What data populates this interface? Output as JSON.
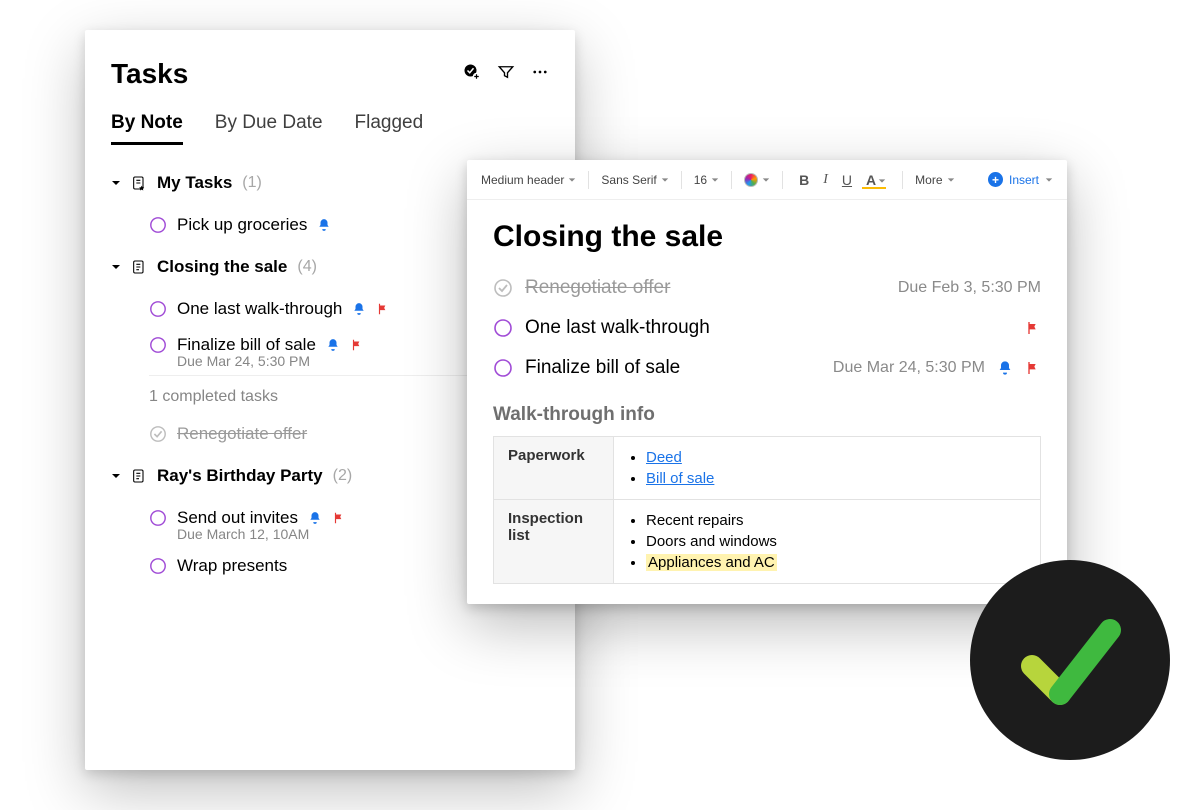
{
  "tasks_panel": {
    "title": "Tasks",
    "tabs": [
      "By Note",
      "By Due Date",
      "Flagged"
    ],
    "groups": [
      {
        "name": "My Tasks",
        "count": "(1)",
        "tasks": [
          {
            "title": "Pick up groceries",
            "subtitle": ""
          }
        ]
      },
      {
        "name": "Closing the sale",
        "count": "(4)",
        "tasks": [
          {
            "title": "One last walk-through",
            "subtitle": ""
          },
          {
            "title": "Finalize bill of sale",
            "subtitle": "Due Mar 24, 5:30 PM"
          }
        ],
        "completed_label": "1 completed tasks",
        "completed": [
          {
            "title": "Renegotiate offer"
          }
        ]
      },
      {
        "name": "Ray's Birthday Party",
        "count": "(2)",
        "tasks": [
          {
            "title": "Send out invites",
            "subtitle": "Due March 12, 10AM"
          },
          {
            "title": "Wrap presents",
            "subtitle": ""
          }
        ]
      }
    ]
  },
  "toolbar": {
    "style": "Medium header",
    "font": "Sans Serif",
    "size": "16",
    "more": "More",
    "insert": "Insert"
  },
  "note": {
    "title": "Closing the sale",
    "tasks": [
      {
        "title": "Renegotiate offer",
        "due": "Due Feb 3, 5:30 PM",
        "done": true
      },
      {
        "title": "One last walk-through",
        "due": "",
        "done": false,
        "flag": true
      },
      {
        "title": "Finalize bill of sale",
        "due": "Due Mar 24, 5:30 PM",
        "done": false,
        "bell": true,
        "flag": true
      }
    ],
    "section": "Walk-through info",
    "table": {
      "rows": [
        {
          "label": "Paperwork",
          "items": [
            "Deed",
            "Bill of sale"
          ],
          "link": true
        },
        {
          "label": "Inspection list",
          "items": [
            "Recent repairs",
            "Doors and windows",
            "Appliances and AC"
          ],
          "highlight_last": true
        }
      ]
    }
  }
}
